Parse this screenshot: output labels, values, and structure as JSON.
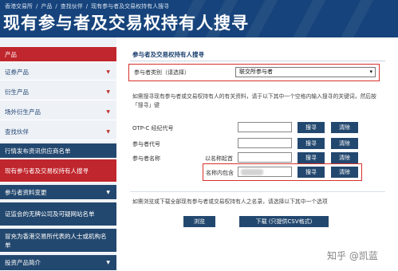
{
  "breadcrumb": [
    "香港交易所",
    "/",
    "产品",
    "/",
    "查找伙伴",
    "/",
    "现有参与者及交易权持有人搜寻"
  ],
  "page_title": "现有参与者及交易权持有人搜寻",
  "sidebar": {
    "items": [
      {
        "label": "产品",
        "arrow": ""
      },
      {
        "label": "证券产品",
        "arrow": "▼"
      },
      {
        "label": "衍生产品",
        "arrow": "▼"
      },
      {
        "label": "场外衍生产品",
        "arrow": "▼"
      },
      {
        "label": "查找伙伴",
        "arrow": "▼"
      },
      {
        "label": "行情发布资讯供应商名单",
        "arrow": ""
      },
      {
        "label": "现有参与者及交易权持有人搜寻",
        "arrow": ""
      },
      {
        "label": "参与者资料变更",
        "arrow": "▼"
      },
      {
        "label": "证监会的无牌公司及可疑网站名单",
        "arrow": ""
      },
      {
        "label": "冒充为香港交易所代表的人士或机构名单",
        "arrow": ""
      },
      {
        "label": "投资产品简介",
        "arrow": "▼"
      }
    ]
  },
  "main": {
    "section_title": "参与者及交易权持有人搜寻",
    "category_label": "参与者类别（请选择）",
    "category_value": "联交所参与者",
    "description": "如需搜寻现有参与者或交易权持有人的有关资料，请于以下其中一个空格内输入搜寻的关键词，然后按「搜寻」键",
    "fields": [
      {
        "label": "OTP-C 经纪代号",
        "sublabel": ""
      },
      {
        "label": "参与者代号",
        "sublabel": ""
      },
      {
        "label": "参与者名称",
        "sublabel": "以名称起首"
      },
      {
        "label": "",
        "sublabel": "名称内包含"
      }
    ],
    "search_label": "搜寻",
    "clear_label": "清除",
    "list_description": "如需浏览或下载全部现有参与者或交易权持有人之名录，请选择以下其中一个选项",
    "browse_label": "浏览",
    "download_label": "下载 (只提供CSV格式)"
  },
  "watermark": "知乎 @凯蓝"
}
